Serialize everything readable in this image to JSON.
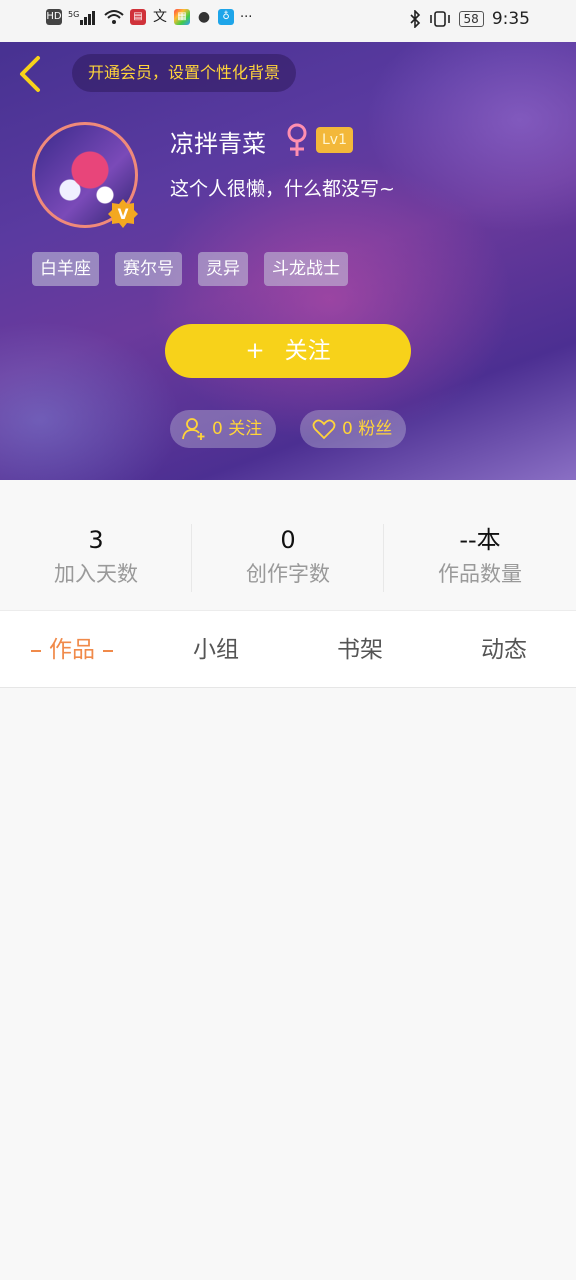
{
  "status_bar": {
    "left_icons": [
      "HD",
      "5G",
      "signal-icon",
      "wifi-icon",
      "book-app-icon",
      "translate-icon",
      "app-icon",
      "chat-icon",
      "lightbulb-icon",
      "more-dots"
    ],
    "more": "···",
    "battery": "58",
    "time": "9:35"
  },
  "header": {
    "vip_promo": "开通会员，设置个性化背景"
  },
  "profile": {
    "username": "凉拌青菜",
    "gender_symbol": "♀",
    "level": "Lv1",
    "bio": "这个人很懒，什么都没写~",
    "verified_mark": "V",
    "tags": [
      "白羊座",
      "赛尔号",
      "灵异",
      "斗龙战士"
    ]
  },
  "actions": {
    "follow_plus": "+",
    "follow_label": "关注",
    "following_count_label": "0 关注",
    "fans_count_label": "0 粉丝"
  },
  "stats": [
    {
      "value": "3",
      "label": "加入天数"
    },
    {
      "value": "0",
      "label": "创作字数"
    },
    {
      "value": "--本",
      "label": "作品数量"
    }
  ],
  "tabs": [
    {
      "label": "作品",
      "active": true
    },
    {
      "label": "小组",
      "active": false
    },
    {
      "label": "书架",
      "active": false
    },
    {
      "label": "动态",
      "active": false
    }
  ],
  "colors": {
    "accent_yellow": "#f7d21a",
    "vip_text": "#ffd43a",
    "active_tab": "#f08a4a",
    "level_badge": "#f3b83a",
    "gender_pink": "#ff8fb0"
  }
}
